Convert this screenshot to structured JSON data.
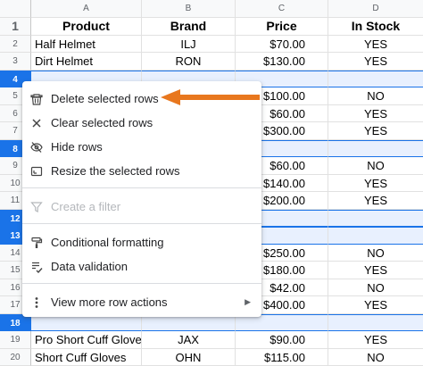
{
  "columns": [
    "A",
    "B",
    "C",
    "D"
  ],
  "header_row": {
    "num": "1",
    "cells": [
      "Product",
      "Brand",
      "Price",
      "In Stock"
    ]
  },
  "rows": [
    {
      "num": "2",
      "selected": false,
      "product": "Half Helmet",
      "brand": "ILJ",
      "price": "$70.00",
      "stock": "YES"
    },
    {
      "num": "3",
      "selected": false,
      "product": "Dirt Helmet",
      "brand": "RON",
      "price": "$130.00",
      "stock": "YES"
    },
    {
      "num": "4",
      "selected": true,
      "product": "",
      "brand": "",
      "price": "",
      "stock": ""
    },
    {
      "num": "5",
      "selected": false,
      "product": "",
      "brand": "",
      "price": "$100.00",
      "stock": "NO"
    },
    {
      "num": "6",
      "selected": false,
      "product": "",
      "brand": "",
      "price": "$60.00",
      "stock": "YES"
    },
    {
      "num": "7",
      "selected": false,
      "product": "",
      "brand": "",
      "price": "$300.00",
      "stock": "YES"
    },
    {
      "num": "8",
      "selected": true,
      "product": "",
      "brand": "",
      "price": "",
      "stock": ""
    },
    {
      "num": "9",
      "selected": false,
      "product": "",
      "brand": "",
      "price": "$60.00",
      "stock": "NO"
    },
    {
      "num": "10",
      "selected": false,
      "product": "",
      "brand": "",
      "price": "$140.00",
      "stock": "YES"
    },
    {
      "num": "11",
      "selected": false,
      "product": "",
      "brand": "",
      "price": "$200.00",
      "stock": "YES"
    },
    {
      "num": "12",
      "selected": true,
      "product": "",
      "brand": "",
      "price": "",
      "stock": ""
    },
    {
      "num": "13",
      "selected": true,
      "product": "",
      "brand": "",
      "price": "",
      "stock": ""
    },
    {
      "num": "14",
      "selected": false,
      "product": "",
      "brand": "",
      "price": "$250.00",
      "stock": "NO"
    },
    {
      "num": "15",
      "selected": false,
      "product": "",
      "brand": "",
      "price": "$180.00",
      "stock": "YES"
    },
    {
      "num": "16",
      "selected": false,
      "product": "",
      "brand": "",
      "price": "$42.00",
      "stock": "NO"
    },
    {
      "num": "17",
      "selected": false,
      "product": "",
      "brand": "",
      "price": "$400.00",
      "stock": "YES"
    },
    {
      "num": "18",
      "selected": true,
      "product": "",
      "brand": "",
      "price": "",
      "stock": ""
    },
    {
      "num": "19",
      "selected": false,
      "product": "Pro Short Cuff Gloves",
      "brand": "JAX",
      "price": "$90.00",
      "stock": "YES"
    },
    {
      "num": "20",
      "selected": false,
      "product": "Short Cuff Gloves",
      "brand": "OHN",
      "price": "$115.00",
      "stock": "NO"
    }
  ],
  "context_menu": {
    "items": [
      {
        "label": "Delete selected rows",
        "icon": "trash-icon",
        "enabled": true
      },
      {
        "label": "Clear selected rows",
        "icon": "close-icon",
        "enabled": true
      },
      {
        "label": "Hide rows",
        "icon": "eye-off-icon",
        "enabled": true
      },
      {
        "label": "Resize the selected rows",
        "icon": "resize-icon",
        "enabled": true
      },
      {
        "label": "Create a filter",
        "icon": "filter-icon",
        "enabled": false
      },
      {
        "label": "Conditional formatting",
        "icon": "paint-roller-icon",
        "enabled": true
      },
      {
        "label": "Data validation",
        "icon": "data-validation-icon",
        "enabled": true
      },
      {
        "label": "View more row actions",
        "icon": "more-vert-icon",
        "enabled": true
      }
    ]
  },
  "colors": {
    "selection": "#1a73e8",
    "selection_fill": "#e8f0fe",
    "arrow": "#e8771e"
  }
}
